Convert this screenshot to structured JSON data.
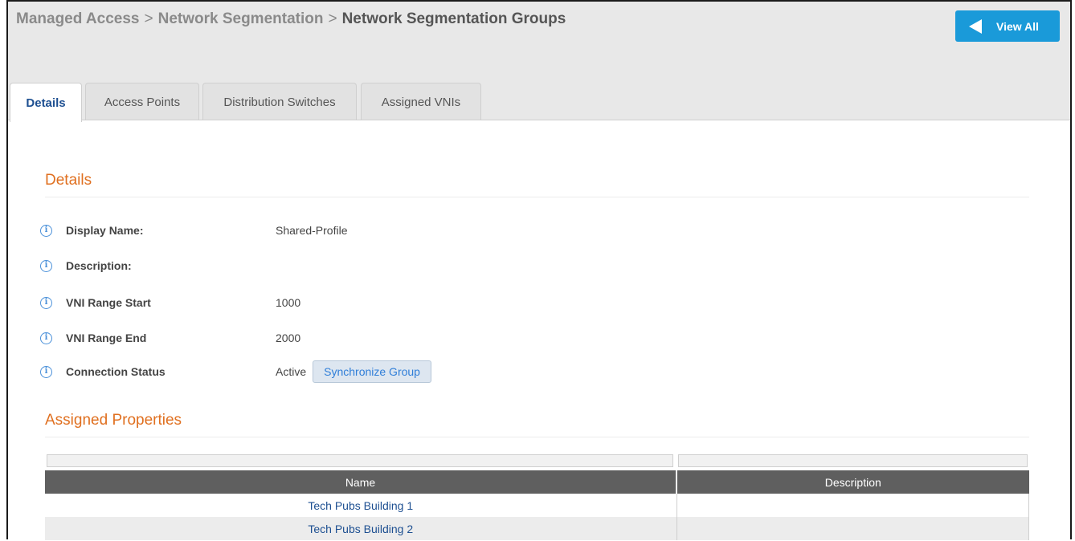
{
  "breadcrumb": {
    "item1": "Managed Access",
    "separator": ">",
    "item2": "Network Segmentation",
    "current": "Network Segmentation Groups"
  },
  "header": {
    "view_all_label": "View All",
    "view_all_icon": "left-triangle-icon"
  },
  "tabs": [
    {
      "label": "Details",
      "active": true
    },
    {
      "label": "Access Points",
      "active": false
    },
    {
      "label": "Distribution Switches",
      "active": false
    },
    {
      "label": "Assigned VNIs",
      "active": false
    }
  ],
  "details": {
    "title": "Details",
    "fields": [
      {
        "label": "Display Name:",
        "value": "Shared-Profile"
      },
      {
        "label": "Description:",
        "value": ""
      },
      {
        "label": "VNI Range Start",
        "value": "1000"
      },
      {
        "label": "VNI Range End",
        "value": "2000"
      },
      {
        "label": "Connection Status",
        "value": "Active"
      }
    ],
    "sync_button_label": "Synchronize Group",
    "info_icon_glyph": "i"
  },
  "assigned": {
    "title": "Assigned Properties",
    "columns": [
      "Name",
      "Description"
    ],
    "rows": [
      {
        "name": "Tech Pubs Building 1",
        "description": ""
      },
      {
        "name": "Tech Pubs Building 2",
        "description": ""
      }
    ]
  },
  "colors": {
    "accent_orange": "#e07020",
    "button_blue": "#1a9ad9",
    "link_blue": "#1d4f91",
    "table_header": "#5f5f5f"
  }
}
